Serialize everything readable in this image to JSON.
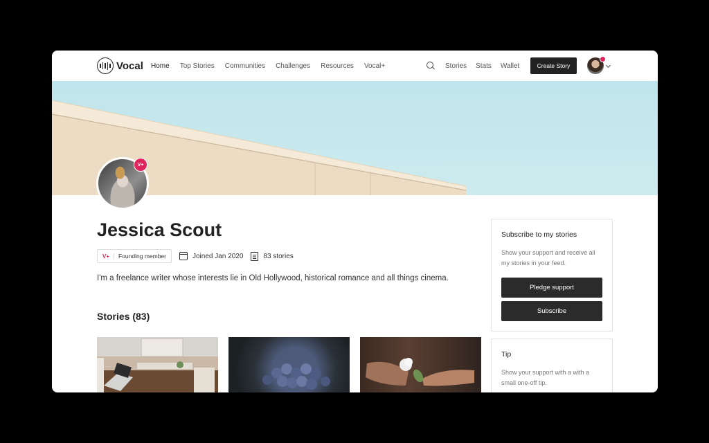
{
  "header": {
    "logo_text": "Vocal",
    "nav": [
      "Home",
      "Top Stories",
      "Communities",
      "Challenges",
      "Resources",
      "Vocal+"
    ],
    "right_nav": [
      "Stories",
      "Stats",
      "Wallet"
    ],
    "create_label": "Create Story",
    "icons": [
      "search-icon",
      "chevron-down-icon"
    ]
  },
  "profile": {
    "badge": "V+",
    "name": "Jessica Scout",
    "founding_vplus": "V+",
    "founding_label": "Founding member",
    "joined": "Joined Jan 2020",
    "story_count": "83 stories",
    "bio": "I'm a freelance writer whose interests lie in Old Hollywood, historical romance and all things cinema."
  },
  "stories": {
    "heading": "Stories (83)"
  },
  "subscribe_card": {
    "title": "Subscribe to my stories",
    "text": "Show your support and receive all my stories in your feed.",
    "pledge_label": "Pledge support",
    "subscribe_label": "Subscribe"
  },
  "tip_card": {
    "title": "Tip",
    "text": "Show your support with a with a small one-off tip."
  },
  "colors": {
    "accent": "#e0245e",
    "button_dark": "#2b2b2b",
    "sky": "#c6e8ee"
  }
}
